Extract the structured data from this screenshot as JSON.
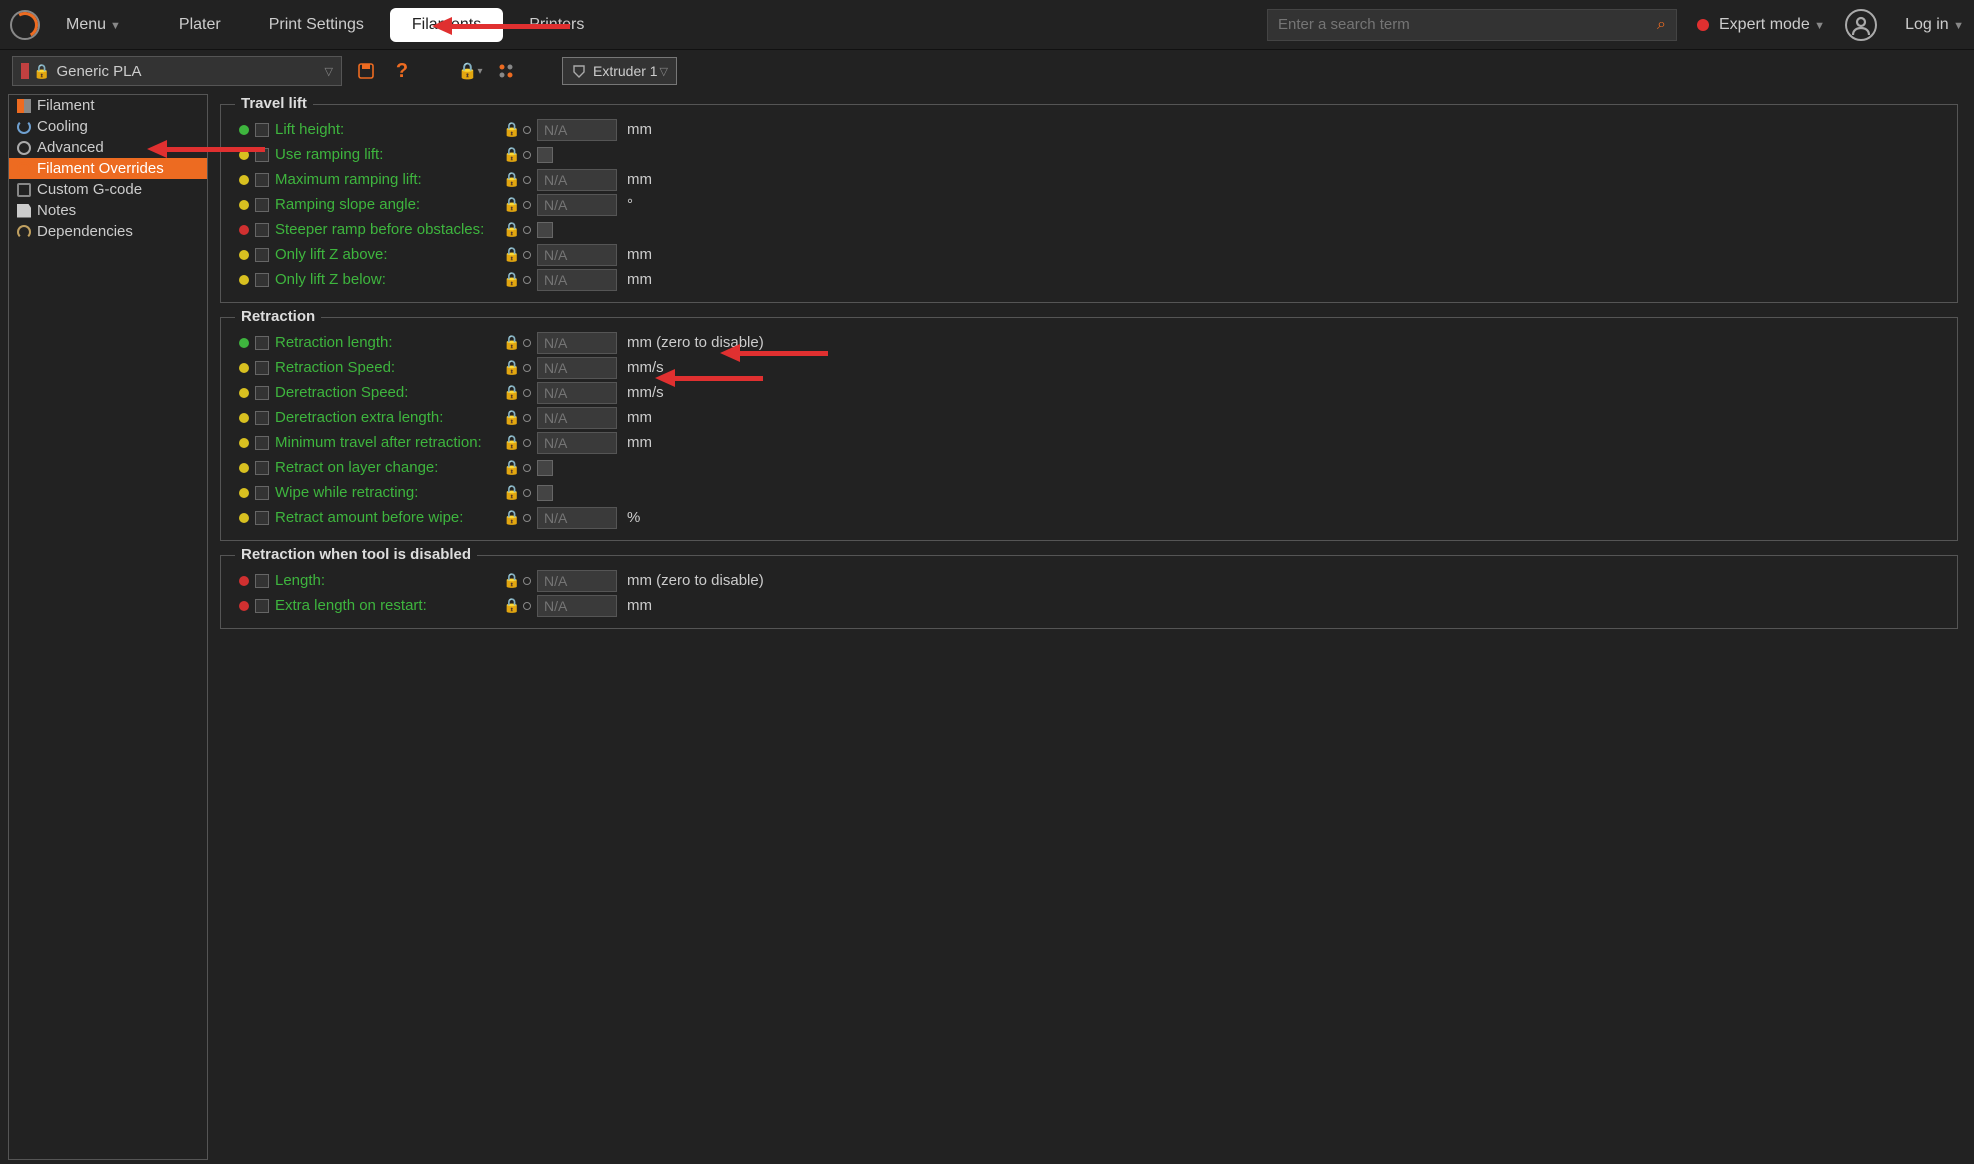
{
  "topbar": {
    "menu": "Menu",
    "tabs": [
      "Plater",
      "Print Settings",
      "Filaments",
      "Printers"
    ],
    "active_tab": 2,
    "search_placeholder": "Enter a search term",
    "expert": "Expert mode",
    "login": "Log in"
  },
  "subbar": {
    "preset": "Generic PLA",
    "extruder": "Extruder 1"
  },
  "sidebar": {
    "items": [
      {
        "label": "Filament",
        "icon": "si-fil"
      },
      {
        "label": "Cooling",
        "icon": "si-cool"
      },
      {
        "label": "Advanced",
        "icon": "si-adv"
      },
      {
        "label": "Filament Overrides",
        "icon": "si-over"
      },
      {
        "label": "Custom G-code",
        "icon": "si-gcode"
      },
      {
        "label": "Notes",
        "icon": "si-notes"
      },
      {
        "label": "Dependencies",
        "icon": "si-dep"
      }
    ],
    "active_index": 3
  },
  "sections": [
    {
      "title": "Travel lift",
      "rows": [
        {
          "bullet": "green",
          "label": "Lift height:",
          "type": "num",
          "unit": "mm",
          "ph": "N/A"
        },
        {
          "bullet": "yellow",
          "label": "Use ramping lift:",
          "type": "check"
        },
        {
          "bullet": "yellow",
          "label": "Maximum ramping lift:",
          "type": "num",
          "unit": "mm",
          "ph": "N/A"
        },
        {
          "bullet": "yellow",
          "label": "Ramping slope angle:",
          "type": "num",
          "unit": "°",
          "ph": "N/A"
        },
        {
          "bullet": "red",
          "label": "Steeper ramp before obstacles:",
          "type": "check"
        },
        {
          "bullet": "yellow",
          "label": "Only lift Z above:",
          "type": "num",
          "unit": "mm",
          "ph": "N/A"
        },
        {
          "bullet": "yellow",
          "label": "Only lift Z below:",
          "type": "num",
          "unit": "mm",
          "ph": "N/A"
        }
      ]
    },
    {
      "title": "Retraction",
      "rows": [
        {
          "bullet": "green",
          "label": "Retraction length:",
          "type": "num",
          "unit": "mm (zero to disable)",
          "ph": "N/A"
        },
        {
          "bullet": "yellow",
          "label": "Retraction Speed:",
          "type": "num",
          "unit": "mm/s",
          "ph": "N/A"
        },
        {
          "bullet": "yellow",
          "label": "Deretraction Speed:",
          "type": "num",
          "unit": "mm/s",
          "ph": "N/A"
        },
        {
          "bullet": "yellow",
          "label": "Deretraction extra length:",
          "type": "num",
          "unit": "mm",
          "ph": "N/A"
        },
        {
          "bullet": "yellow",
          "label": "Minimum travel after retraction:",
          "type": "num",
          "unit": "mm",
          "ph": "N/A"
        },
        {
          "bullet": "yellow",
          "label": "Retract on layer change:",
          "type": "check"
        },
        {
          "bullet": "yellow",
          "label": "Wipe while retracting:",
          "type": "check"
        },
        {
          "bullet": "yellow",
          "label": "Retract amount before wipe:",
          "type": "num",
          "unit": "%",
          "ph": "N/A"
        }
      ]
    },
    {
      "title": "Retraction when tool is disabled",
      "rows": [
        {
          "bullet": "red",
          "label": "Length:",
          "type": "num",
          "unit": "mm (zero to disable)",
          "ph": "N/A"
        },
        {
          "bullet": "red",
          "label": "Extra length on restart:",
          "type": "num",
          "unit": "mm",
          "ph": "N/A"
        }
      ]
    }
  ]
}
